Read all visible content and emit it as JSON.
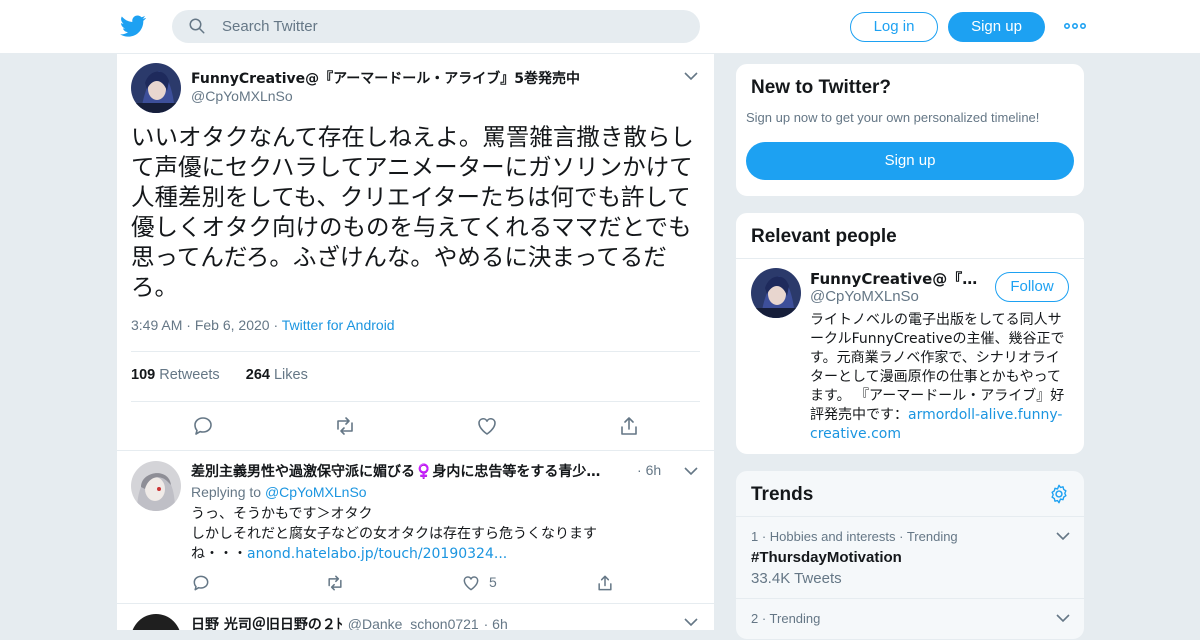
{
  "header": {
    "logo_icon": "twitter-bird-icon",
    "search_placeholder": "Search Twitter",
    "login_label": "Log in",
    "signup_label": "Sign up",
    "more_icon": "more-dots-icon",
    "brand_color": "#1da1f2"
  },
  "main_tweet": {
    "name": "FunnyCreative@『アーマードール・アライブ』5巻発売中",
    "handle": "@CpYoMXLnSo",
    "text": "いいオタクなんて存在しねえよ。罵詈雑言撒き散らして声優にセクハラしてアニメーターにガソリンかけて人種差別をしても、クリエイターたちは何でも許して優しくオタク向けのものを与えてくれるママだとでも思ってんだろ。ふざけんな。やめるに決まってるだろ。",
    "time": "3:49 AM",
    "date": "Feb 6, 2020",
    "source": "Twitter for Android",
    "retweets_count": "109",
    "retweets_label": "Retweets",
    "likes_count": "264",
    "likes_label": "Likes"
  },
  "replies": [
    {
      "name": "差別主義男性や過激保守派に媚びる♀️身内に忠告等をする青少…",
      "time": "6h",
      "replying_label": "Replying to",
      "replying_to": "@CpYoMXLnSo",
      "text_line1": "うっ、そうかもです＞オタク",
      "text_line2": "しかしそれだと腐女子などの女オタクは存在すら危うくなります",
      "text_line3": "ね・・・",
      "link": "anond.hatelabo.jp/touch/20190324...",
      "likes": "5"
    },
    {
      "name": "日野 光司＠旧日野の２ﾄ",
      "handle": "@Danke_schon0721",
      "time": "6h"
    }
  ],
  "new_to_twitter": {
    "title": "New to Twitter?",
    "subtitle": "Sign up now to get your own personalized timeline!",
    "button": "Sign up"
  },
  "relevant_people": {
    "title": "Relevant people",
    "name": "FunnyCreative@『アー…",
    "handle": "@CpYoMXLnSo",
    "follow_label": "Follow",
    "bio": "ライトノベルの電子出版をしてる同人サークルFunnyCreativeの主催、幾谷正です。元商業ラノベ作家で、シナリオライターとして漫画原作の仕事とかもやってます。 『アーマードール・アライブ』好評発売中です：",
    "bio_link": "armordoll-alive.funny-creative.com"
  },
  "trends": {
    "title": "Trends",
    "settings_icon": "gear-icon",
    "items": [
      {
        "meta": "1 · Hobbies and interests · Trending",
        "tag": "#ThursdayMotivation",
        "count": "33.4K Tweets"
      },
      {
        "meta": "2 · Trending"
      }
    ]
  }
}
